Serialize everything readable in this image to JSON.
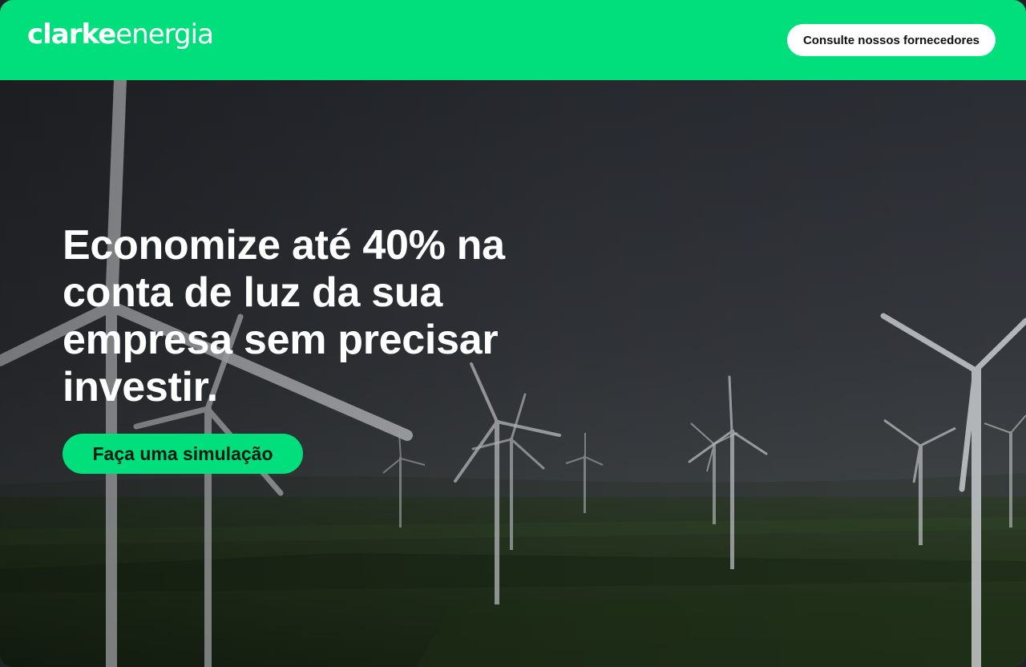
{
  "header": {
    "logo_part1": "clarke",
    "logo_part2": "energia",
    "suppliers_button": "Consulte nossos fornecedores"
  },
  "hero": {
    "headline": "Economize até 40% na conta de luz da sua empresa sem precisar investir.",
    "cta_button": "Faça uma simulação",
    "background_image": "wind-turbines-field-photo"
  },
  "colors": {
    "brand_green": "#00df7c",
    "text_white": "#ffffff",
    "sky_dark": "#2b2f35",
    "field_dark_green": "#243320"
  }
}
